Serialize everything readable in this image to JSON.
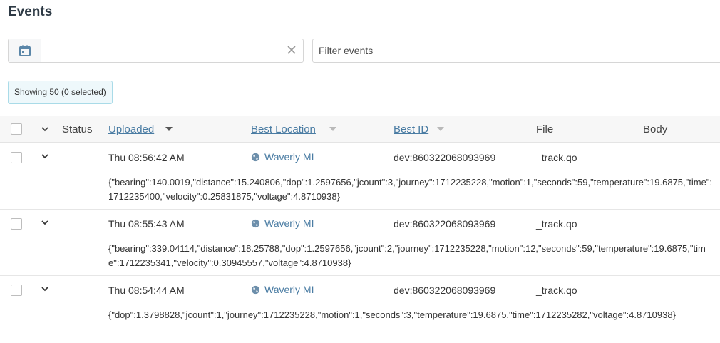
{
  "page": {
    "title": "Events"
  },
  "filters": {
    "date_value": "",
    "filter_placeholder": "Filter events"
  },
  "selection": {
    "showing_label": "Showing 50 (0 selected)"
  },
  "columns": {
    "status": "Status",
    "uploaded": "Uploaded",
    "best_location": "Best Location",
    "best_id": "Best ID",
    "file": "File",
    "body": "Body"
  },
  "events": [
    {
      "uploaded": "Thu 08:56:42 AM",
      "location": "Waverly MI",
      "best_id": "dev:860322068093969",
      "file": "_track.qo",
      "body": "{\"bearing\":140.0019,\"distance\":15.240806,\"dop\":1.2597656,\"jcount\":3,\"journey\":1712235228,\"motion\":1,\"seconds\":59,\"temperature\":19.6875,\"time\":1712235400,\"velocity\":0.25831875,\"voltage\":4.8710938}"
    },
    {
      "uploaded": "Thu 08:55:43 AM",
      "location": "Waverly MI",
      "best_id": "dev:860322068093969",
      "file": "_track.qo",
      "body": "{\"bearing\":339.04114,\"distance\":18.25788,\"dop\":1.2597656,\"jcount\":2,\"journey\":1712235228,\"motion\":12,\"seconds\":59,\"temperature\":19.6875,\"time\":1712235341,\"velocity\":0.30945557,\"voltage\":4.8710938}"
    },
    {
      "uploaded": "Thu 08:54:44 AM",
      "location": "Waverly MI",
      "best_id": "dev:860322068093969",
      "file": "_track.qo",
      "body": "{\"dop\":1.3798828,\"jcount\":1,\"journey\":1712235228,\"motion\":1,\"seconds\":3,\"temperature\":19.6875,\"time\":1712235282,\"voltage\":4.8710938}"
    }
  ],
  "colors": {
    "link": "#4a7ca3",
    "header_bg": "#f7f7f7",
    "badge_bg": "#eef8fb",
    "badge_border": "#a9dbe8"
  }
}
